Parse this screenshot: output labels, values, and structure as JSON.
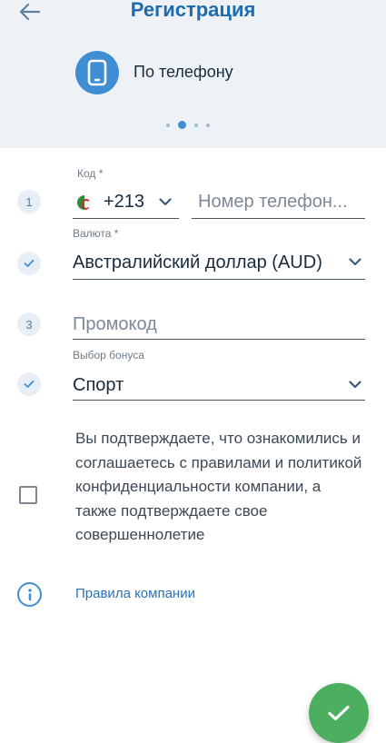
{
  "header": {
    "title": "Регистрация",
    "method_label": "По телефону",
    "back_icon": "arrow-left-icon",
    "method_icon": "smartphone-icon",
    "carousel_dots": 4,
    "carousel_active_index": 1
  },
  "form": {
    "phone_step": "1",
    "code_label": "Код *",
    "country_code": "+213",
    "country_flag": "algeria-flag-icon",
    "phone_placeholder": "Номер телефон...",
    "currency_label": "Валюта *",
    "currency_value": "Австралийский доллар (AUD)",
    "promo_step": "3",
    "promo_placeholder": "Промокод",
    "bonus_label": "Выбор бонуса",
    "bonus_value": "Спорт"
  },
  "consent": {
    "text": "Вы подтверждаете, что ознакомились и соглашаетесь с правилами и политикой конфиденциальности компании, а также подтверждаете свое совершеннолетие",
    "checked": false
  },
  "rules_link": "Правила компании",
  "colors": {
    "accent": "#3f8ed4",
    "title": "#1e6bb0",
    "submit": "#4caf5f",
    "header_bg": "#eef2f6"
  }
}
